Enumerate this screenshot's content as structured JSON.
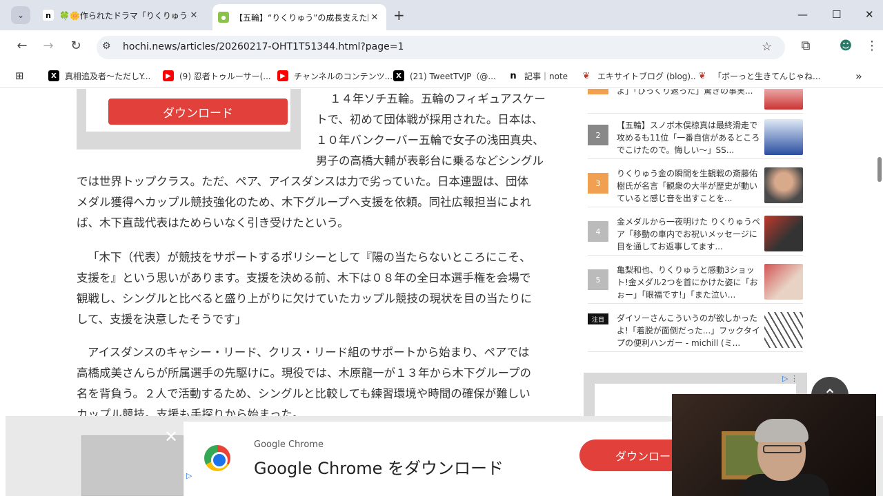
{
  "browser": {
    "tabs": [
      {
        "favicon": "n",
        "title": "🍀🌼作られたドラマ「りくりゅう」：",
        "active": false
      },
      {
        "favicon": "hochi",
        "title": "【五輪】“りくりゅう”の成長支えた陰の",
        "active": true
      }
    ],
    "url": "hochi.news/articles/20260217-OHT1T51344.html?page=1",
    "bookmarks": [
      {
        "icon": "x-icon",
        "label": "真相追及者～ただしY..."
      },
      {
        "icon": "youtube-icon",
        "label": "(9) 忍者トゥルーサー(..."
      },
      {
        "icon": "youtube-icon",
        "label": "チャンネルのコンテンツ..."
      },
      {
        "icon": "x-icon",
        "label": "(21) TweetTVJP（@..."
      },
      {
        "icon": "note-icon",
        "label": "記事｜note"
      },
      {
        "icon": "excite-icon",
        "label": "エキサイトブログ (blog)..."
      },
      {
        "icon": "excite-icon",
        "label": "「ボーっと生きてんじゃね..."
      }
    ]
  },
  "ad_top": {
    "button": "ダウンロード"
  },
  "article": {
    "lines": [
      "１４年ソチ五輪。五輪のフィギュアスケー",
      "トで、初めて団体戦が採用された。日本は、",
      "１０年バンクーバー五輪で女子の浅田真央、",
      "男子の高橋大輔が表彰台に乗るなどシングル",
      "では世界トップクラス。ただ、ペア、アイスダンスは力で劣っていた。日本連盟は、団体",
      "メダル獲得へカップル競技強化のため、木下グループへ支援を依頼。同社広報担当によれ",
      "ば、木下直哉代表はためらいなく引き受けたという。",
      "「木下（代表）が競技をサポートするポリシーとして『陽の当たらないところにこそ、",
      "支援を』という思いがあります。支援を決める前、木下は０８年の全日本選手権を会場で",
      "観戦し、シングルと比べると盛り上がりに欠けていたカップル競技の現状を目の当たりに",
      "して、支援を決意したそうです」",
      "アイスダンスのキャシー・リード、クリス・リード組のサポートから始まり、ペアでは",
      "高橋成美さんらが所属選手の先駆けに。現役では、木原龍一が１３年から木下グループの",
      "名を背負う。２人で活動するため、シングルと比較しても練習環境や時間の確保が難しい",
      "カップル競技。支援も手探りから始まった。"
    ]
  },
  "ranking": [
    {
      "num": "",
      "text": "よ」「ひっくり返った」驚きの事実..."
    },
    {
      "num": "2",
      "text": "【五輪】スノボ木俣椋真は最終滑走で攻めるも11位「一番自信があるところでこけたので。悔しい～」SS..."
    },
    {
      "num": "3",
      "text": "りくりゅう金の瞬間を生観戦の斎藤佑樹氏が名言「観衆の大半が歴史が動いていると感じ音を出すことを..."
    },
    {
      "num": "4",
      "text": "金メダルから一夜明けた りくりゅうペア「移動の車内でお祝いメッセージに目を通してお返事してます..."
    },
    {
      "num": "5",
      "text": "亀梨和也、りくりゅうと感動3ショット!金メダル2つを首にかけた姿に「おぉー」「眼福です!」「また泣い..."
    },
    {
      "num": "注目",
      "text": "ダイソーさんこういうのが欲しかったよ!「着脱が面倒だった...」フックタイプの便利ハンガー - michill (ミ..."
    }
  ],
  "bottom_ad": {
    "close": "✕",
    "brand": "Google Chrome",
    "headline": "Google Chrome をダウンロード",
    "button": "ダウンロード"
  },
  "colors": {
    "accent_red": "#e2403b",
    "rank_orange": "#f0a050",
    "chrome_blue": "#1a73e8"
  }
}
